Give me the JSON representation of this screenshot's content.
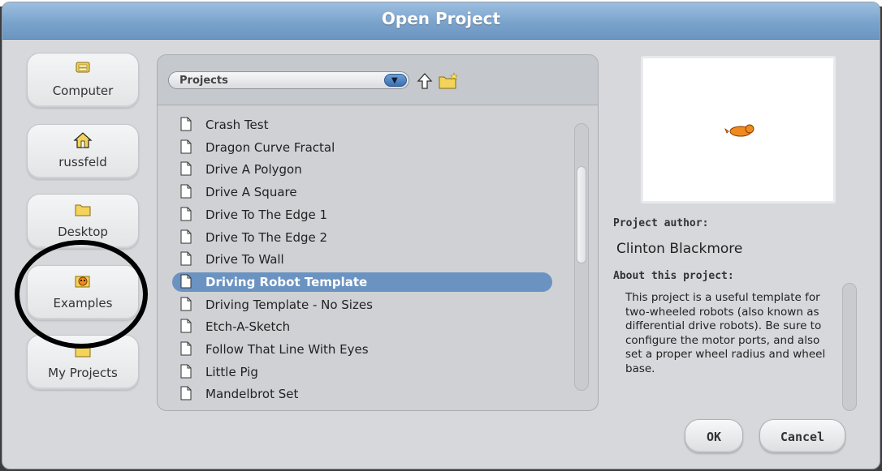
{
  "window": {
    "title": "Open Project"
  },
  "places": [
    {
      "label": "Computer",
      "icon": "computer-icon"
    },
    {
      "label": "russfeld",
      "icon": "home-icon"
    },
    {
      "label": "Desktop",
      "icon": "folder-icon"
    },
    {
      "label": "Examples",
      "icon": "scratch-cat-icon"
    },
    {
      "label": "My Projects",
      "icon": "folder-icon"
    }
  ],
  "browser": {
    "folder": "Projects",
    "files": [
      {
        "name": "Crash Test",
        "selected": false
      },
      {
        "name": "Dragon Curve Fractal",
        "selected": false
      },
      {
        "name": "Drive A Polygon",
        "selected": false
      },
      {
        "name": "Drive A Square",
        "selected": false
      },
      {
        "name": "Drive To The Edge 1",
        "selected": false
      },
      {
        "name": "Drive To The Edge 2",
        "selected": false
      },
      {
        "name": "Drive To Wall",
        "selected": false
      },
      {
        "name": "Driving Robot Template",
        "selected": true
      },
      {
        "name": "Driving Template - No Sizes",
        "selected": false
      },
      {
        "name": "Etch-A-Sketch",
        "selected": false
      },
      {
        "name": "Follow That Line With Eyes",
        "selected": false
      },
      {
        "name": "Little Pig",
        "selected": false
      },
      {
        "name": "Mandelbrot Set",
        "selected": false
      }
    ]
  },
  "details": {
    "author_label": "Project author:",
    "author": "Clinton Blackmore",
    "about_label": "About this project:",
    "about": "This project is a useful template for two-wheeled robots (also known as differential drive robots).  Be sure to configure the motor ports, and also set a proper wheel radius and wheel base."
  },
  "buttons": {
    "ok": "OK",
    "cancel": "Cancel"
  },
  "colors": {
    "title_bar": "#7aa3cc",
    "selection": "#6a93c2",
    "annotation_ring": "#000000"
  }
}
